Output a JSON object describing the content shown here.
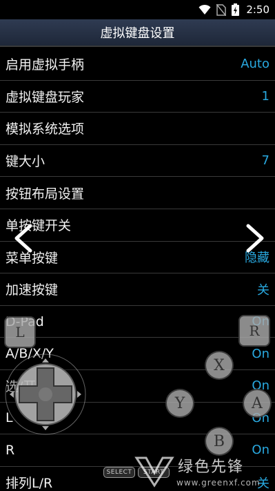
{
  "status_bar": {
    "time": "2:50",
    "icons": [
      "wifi-icon",
      "no-sim-icon",
      "battery-icon"
    ]
  },
  "header": {
    "title": "虚拟键盘设置"
  },
  "settings": [
    {
      "label": "启用虚拟手柄",
      "value": "Auto"
    },
    {
      "label": "虚拟键盘玩家",
      "value": "1"
    },
    {
      "label": "模拟系统选项",
      "value": ""
    },
    {
      "label": "键大小",
      "value": "7"
    },
    {
      "label": "按钮布局设置",
      "value": ""
    },
    {
      "label": "单按键开关",
      "value": ""
    },
    {
      "label": "菜单按键",
      "value": "隐藏"
    },
    {
      "label": "加速按键",
      "value": "关"
    },
    {
      "label": "D-Pad",
      "value": "On"
    },
    {
      "label": "A/B/X/Y",
      "value": "On"
    },
    {
      "label": "选/开始",
      "value": "On"
    },
    {
      "label": "L",
      "value": "On"
    },
    {
      "label": "R",
      "value": "On"
    },
    {
      "label": "排列L/R",
      "value": "关"
    }
  ],
  "overlay": {
    "btn_l": "L",
    "btn_r": "R",
    "btn_x": "X",
    "btn_y": "Y",
    "btn_a": "A",
    "btn_b": "B",
    "select": "SELECT",
    "start": "START"
  },
  "watermark": {
    "text": "绿色先锋",
    "url": "www.greenxf.com"
  },
  "colors": {
    "accent": "#29a9e0",
    "header": "#2a3447",
    "divider": "#3a3a3a"
  }
}
